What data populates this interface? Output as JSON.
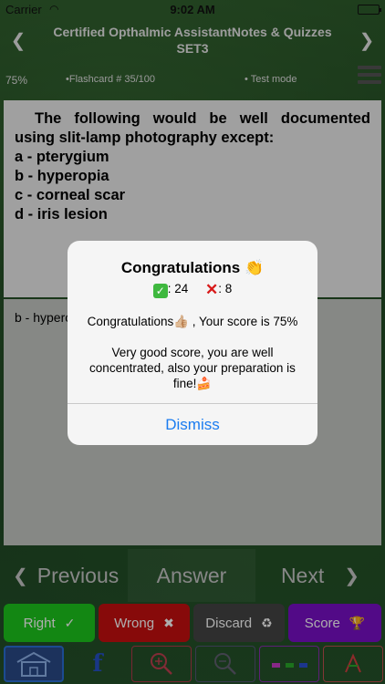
{
  "status_bar": {
    "carrier": "Carrier",
    "time": "9:02 AM",
    "wifi_icon": "wifi-icon",
    "battery_level": 1.0
  },
  "header": {
    "title_line1": "Certified Opthalmic AssistantNotes & Quizzes",
    "title_line2": "SET3",
    "left_arrow": "❮",
    "right_arrow": "❯"
  },
  "info": {
    "score_percent": "75%",
    "flashcard": "•Flashcard #  35/100",
    "mode": "• Test mode"
  },
  "question": {
    "text": "The following would be well documented using slit-lamp photography except:",
    "options": [
      "a - pterygium",
      "b - hyperopia",
      "c - corneal scar",
      "d - iris lesion"
    ]
  },
  "answer": {
    "text": "b - hyperopia"
  },
  "nav": {
    "previous": "Previous",
    "answer": "Answer",
    "next": "Next",
    "prev_arrow": "❮",
    "next_arrow": "❯"
  },
  "actions": {
    "right": "Right",
    "right_icon": "✓",
    "wrong": "Wrong",
    "wrong_icon": "✖",
    "discard": "Discard",
    "discard_icon": "♻",
    "score": "Score",
    "score_icon": "🏆"
  },
  "toolbar": {
    "home_icon": "home-icon",
    "facebook_icon": "f",
    "zoom_in_icon": "zoom-in-icon",
    "zoom_out_icon": "zoom-out-icon",
    "colors_icon": "colors-icon",
    "font_icon": "A"
  },
  "alert": {
    "title": "Congratulations",
    "title_emoji": "👏",
    "right_count": ": 24",
    "wrong_count": ": 8",
    "message1": "Congratulations👍🏼 , Your score is 75%",
    "message2": "Very good score, you are well concentrated, also your preparation is fine!🍰",
    "dismiss": "Dismiss"
  },
  "colors": {
    "right": "#1dc71d",
    "wrong": "#c81010",
    "discard": "#444444",
    "score": "#7a0fc8",
    "link": "#1a7cf0"
  }
}
